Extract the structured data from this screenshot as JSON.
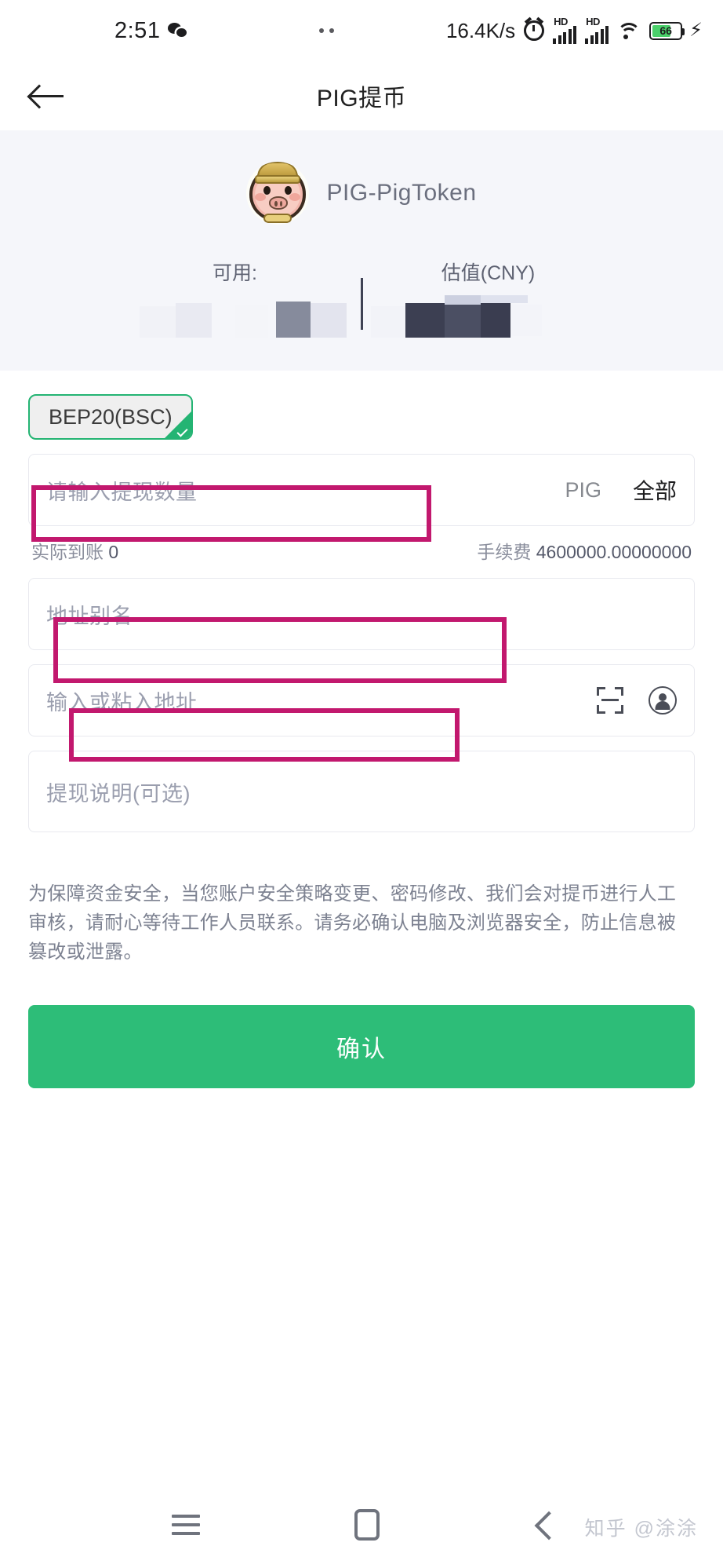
{
  "status_bar": {
    "time": "2:51",
    "wechat_icon": "wechat-icon",
    "network_speed": "16.4K/s",
    "alarm_icon": "alarm-icon",
    "hd_label_1": "HD",
    "hd_label_2": "HD",
    "wifi_icon": "wifi-icon",
    "battery_percent": "66",
    "charging_icon": "⚡"
  },
  "header": {
    "back_icon": "back-arrow-icon",
    "title": "PIG提币"
  },
  "token": {
    "avatar_icon": "pig-token-avatar",
    "name": "PIG-PigToken",
    "available_label": "可用:",
    "available_value_hidden": "",
    "valuation_label": "估值(CNY)",
    "valuation_value_hidden": ""
  },
  "network": {
    "chip_label": "BEP20(BSC)",
    "selected_icon": "check-icon",
    "accent_color": "#24b473"
  },
  "amount": {
    "placeholder": "请输入提现数量",
    "value": "",
    "unit": "PIG",
    "all_label": "全部"
  },
  "meta": {
    "received_label": "实际到账",
    "received_value": "0",
    "fee_label": "手续费",
    "fee_value": "4600000.00000000"
  },
  "alias": {
    "placeholder": "地址别名",
    "value": ""
  },
  "address": {
    "placeholder": "输入或粘入地址",
    "value": "",
    "scan_icon": "scan-qr-icon",
    "contact_icon": "address-book-icon"
  },
  "note": {
    "placeholder": "提现说明(可选)",
    "value": ""
  },
  "disclaimer": {
    "text": "为保障资金安全，当您账户安全策略变更、密码修改、我们会对提币进行人工审核，请耐心等待工作人员联系。请务必确认电脑及浏览器安全，防止信息被篡改或泄露。"
  },
  "confirm": {
    "label": "确认",
    "color": "#2dbd78"
  },
  "annotations": {
    "color": "#c2186e",
    "boxes": [
      "amount-input-highlight",
      "alias-input-highlight",
      "address-input-highlight"
    ]
  },
  "navbar": {
    "recents_icon": "recents-icon",
    "home_icon": "home-icon",
    "back_icon": "back-icon"
  },
  "watermark": {
    "text": "知乎 @涂涂"
  }
}
